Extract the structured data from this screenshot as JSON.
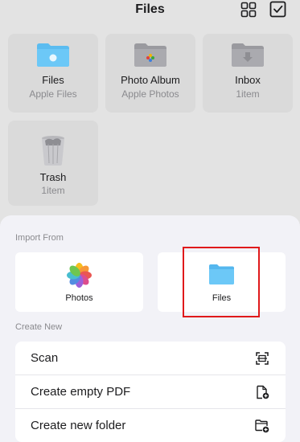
{
  "header": {
    "title": "Files",
    "grid_icon": "grid-view-icon",
    "select_icon": "checkbox-select-icon"
  },
  "folders": [
    {
      "name": "Files",
      "subtitle": "Apple Files",
      "icon": "folder-icon"
    },
    {
      "name": "Photo Album",
      "subtitle": "Apple Photos",
      "icon": "photos-folder-icon"
    },
    {
      "name": "Inbox",
      "subtitle": "1item",
      "icon": "inbox-folder-icon"
    },
    {
      "name": "Trash",
      "subtitle": "1item",
      "icon": "trash-icon"
    }
  ],
  "sheet": {
    "import_label": "Import From",
    "import_options": [
      {
        "label": "Photos",
        "icon": "photos-app-icon"
      },
      {
        "label": "Files",
        "icon": "folder-icon"
      }
    ],
    "create_label": "Create New",
    "create_options": [
      {
        "label": "Scan",
        "icon": "scan-icon"
      },
      {
        "label": "Create empty PDF",
        "icon": "new-pdf-icon"
      },
      {
        "label": "Create new folder",
        "icon": "new-folder-icon"
      }
    ]
  },
  "colors": {
    "folder_blue": "#5bbcf0",
    "folder_gray": "#a8a8ad",
    "highlight_red": "#e0191b",
    "sheet_background": "#f2f2f7"
  }
}
